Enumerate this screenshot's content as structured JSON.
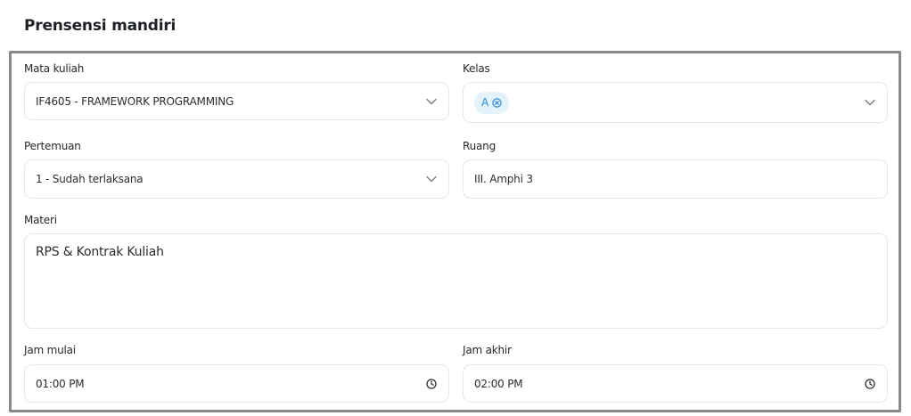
{
  "page": {
    "title": "Prensensi mandiri"
  },
  "form": {
    "course": {
      "label": "Mata kuliah",
      "value": "IF4605 - FRAMEWORK PROGRAMMING"
    },
    "class": {
      "label": "Kelas",
      "tags": [
        {
          "text": "A"
        }
      ]
    },
    "meeting": {
      "label": "Pertemuan",
      "value": "1 - Sudah terlaksana"
    },
    "room": {
      "label": "Ruang",
      "value": "III. Amphi 3"
    },
    "material": {
      "label": "Materi",
      "value": "RPS & Kontrak Kuliah"
    },
    "start_time": {
      "label": "Jam mulai",
      "value": "01:00 PM"
    },
    "end_time": {
      "label": "Jam akhir",
      "value": "02:00 PM"
    }
  },
  "icons": {
    "dropdown": "chevron-down-icon",
    "remove_tag": "close-circle-icon",
    "time": "clock-icon"
  },
  "colors": {
    "frame_border": "#8a8a8a",
    "field_border": "#e4e6ea",
    "tag_bg": "#e3f2fb",
    "tag_text": "#2b8ad6"
  }
}
